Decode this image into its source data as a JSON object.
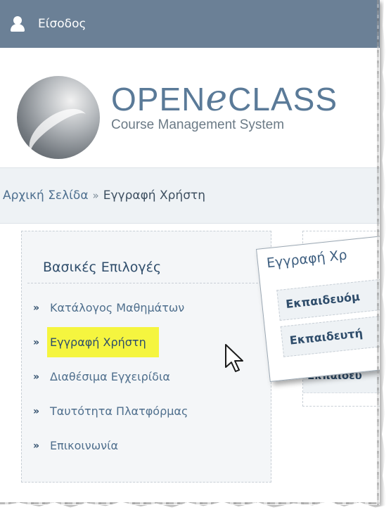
{
  "topbar": {
    "login_label": "Είσοδος",
    "icon": "user-icon"
  },
  "logo": {
    "title_part1": "OPEN",
    "title_e": "e",
    "title_part2": "CLASS",
    "subtitle": "Course Management System"
  },
  "breadcrumb": {
    "home": "Αρχική Σελίδα",
    "separator": "»",
    "current": "Εγγραφή Χρήστη"
  },
  "menu": {
    "title": "Βασικές Επιλογές",
    "bullet": "»",
    "items": [
      {
        "label": "Κατάλογος Μαθημάτων"
      },
      {
        "label": "Εγγραφή Χρήστη",
        "highlighted": true
      },
      {
        "label": "Διαθέσιμα Εγχειρίδια"
      },
      {
        "label": "Ταυτότητα Πλατφόρμας"
      },
      {
        "label": "Επικοινωνία"
      }
    ]
  },
  "callout": {
    "title": "Εγγραφή Χρ",
    "rows": [
      "Εκπαιδευόμ",
      "Εκπαιδευτή"
    ]
  },
  "right_panel": {
    "rows": [
      "Εκπαιδευ"
    ]
  },
  "colors": {
    "topbar": "#6b8096",
    "highlight": "#f5f53f",
    "link": "#4f6f8d"
  }
}
